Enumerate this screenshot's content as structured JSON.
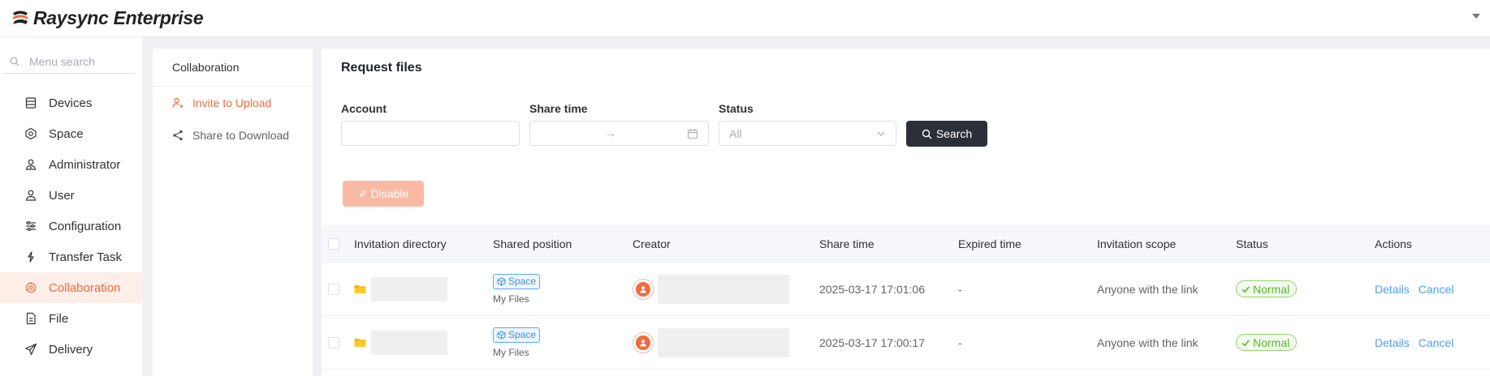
{
  "header": {
    "app_name": "Raysync Enterprise"
  },
  "sidebar": {
    "search_placeholder": "Menu search",
    "items": [
      {
        "label": "Devices",
        "icon": "devices-icon"
      },
      {
        "label": "Space",
        "icon": "space-icon"
      },
      {
        "label": "Administrator",
        "icon": "administrator-icon"
      },
      {
        "label": "User",
        "icon": "user-icon"
      },
      {
        "label": "Configuration",
        "icon": "configuration-icon"
      },
      {
        "label": "Transfer Task",
        "icon": "transfer-task-icon"
      },
      {
        "label": "Collaboration",
        "icon": "collaboration-icon",
        "active": true
      },
      {
        "label": "File",
        "icon": "file-icon"
      },
      {
        "label": "Delivery",
        "icon": "delivery-icon"
      }
    ]
  },
  "subpanel": {
    "title": "Collaboration",
    "items": [
      {
        "label": "Invite to Upload",
        "active": true
      },
      {
        "label": "Share to Download"
      }
    ]
  },
  "main": {
    "title": "Request files",
    "filters": {
      "account_label": "Account",
      "account_value": "",
      "share_time_label": "Share time",
      "range_separator": "→",
      "status_label": "Status",
      "status_placeholder": "All"
    },
    "search_label": "Search",
    "disable_label": "Disable",
    "table": {
      "headers": [
        "Invitation directory",
        "Shared position",
        "Creator",
        "Share time",
        "Expired time",
        "Invitation scope",
        "Status",
        "Actions"
      ],
      "rows": [
        {
          "position_tag": "Space",
          "position_sub": "My Files",
          "share_time": "2025-03-17 17:01:06",
          "expired_time": "-",
          "scope": "Anyone with the link",
          "status": "Normal",
          "action_details": "Details",
          "action_cancel": "Cancel"
        },
        {
          "position_tag": "Space",
          "position_sub": "My Files",
          "share_time": "2025-03-17 17:00:17",
          "expired_time": "-",
          "scope": "Anyone with the link",
          "status": "Normal",
          "action_details": "Details",
          "action_cancel": "Cancel"
        }
      ]
    }
  },
  "colors": {
    "accent": "#f26a3d",
    "active_bg": "#fdeee8",
    "link": "#4e9df5",
    "status_green": "#58b62f",
    "button_dark": "#2b2f38"
  }
}
